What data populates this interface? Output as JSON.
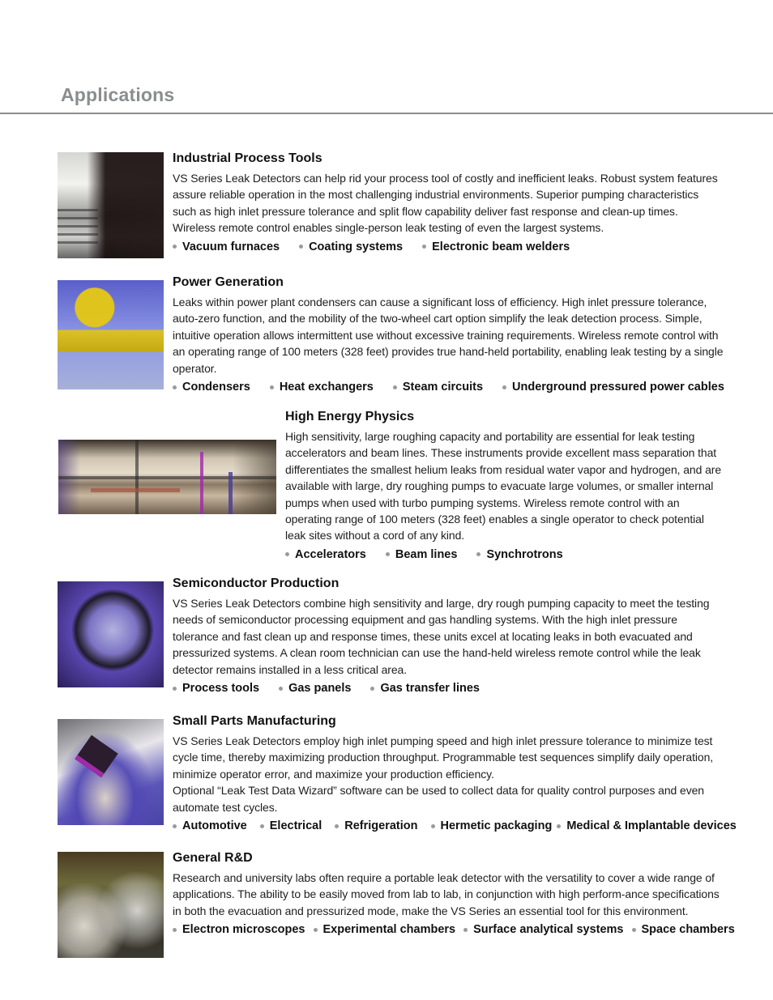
{
  "page": {
    "title": "Applications"
  },
  "sections": [
    {
      "id": "industrial",
      "heading": "Industrial Process Tools",
      "image": "industrial-process-tool-photo",
      "body": "VS Series Leak Detectors can help rid your process tool of costly and inefficient leaks. Robust system features assure reliable operation in the most challenging industrial environments. Superior pumping characteristics such as high inlet pressure tolerance and split flow capability deliver fast response and clean-up times. Wireless remote control enables single-person leak testing of even the largest systems.",
      "bullets": [
        "Vacuum furnaces",
        "Coating systems",
        "Electronic beam welders"
      ]
    },
    {
      "id": "power",
      "heading": "Power Generation",
      "image": "power-plant-valve-photo",
      "body": "Leaks within power plant condensers can cause a significant loss of efficiency. High inlet pressure tolerance, auto-zero function, and the mobility of the two-wheel cart option simplify the leak detection process. Simple, intuitive operation allows intermittent use without excessive training requirements. Wireless remote control with an operating range of 100 meters (328 feet) provides true hand-held portability, enabling leak testing by a single operator.",
      "bullets": [
        "Condensers",
        "Heat exchangers",
        "Steam circuits",
        "Underground pressured power cables"
      ]
    },
    {
      "id": "physics",
      "heading": "High Energy Physics",
      "image": "accelerator-tunnel-photo",
      "body": "High sensitivity, large roughing capacity and portability are essential for leak testing accelerators and beam lines. These instruments provide excellent mass separation that differentiates the smallest helium leaks from residual water vapor and hydrogen, and are available with large, dry roughing pumps to evacuate large volumes, or smaller internal pumps when used with turbo pumping systems. Wireless remote control with an operating range of 100 meters (328 feet) enables a single operator to check potential leak sites without a cord of any kind.",
      "bullets": [
        "Accelerators",
        "Beam lines",
        "Synchrotrons"
      ]
    },
    {
      "id": "semiconductor",
      "heading": "Semiconductor Production",
      "image": "silicon-wafer-photo",
      "body": "VS Series Leak Detectors combine high sensitivity and large, dry rough pumping capacity to meet the testing needs of semiconductor processing equipment and gas handling systems. With the high inlet pressure tolerance and fast clean up and response times, these units excel at locating leaks in both evacuated and pressurized systems. A clean room technician can use the hand-held wireless remote control while the leak detector remains installed in a less critical area.",
      "bullets": [
        "Process tools",
        "Gas panels",
        "Gas transfer lines"
      ]
    },
    {
      "id": "smallparts",
      "heading": "Small Parts Manufacturing",
      "image": "microscope-circuit-photo",
      "body": "VS Series Leak Detectors employ high inlet pumping speed and high inlet pressure tolerance to minimize test cycle time, thereby maximizing production throughput. Programmable test sequences simplify daily operation, minimize operator error, and maximize your production efficiency.",
      "body2": "Optional “Leak Test Data Wizard” software can be used to collect data for quality control purposes and even automate test cycles.",
      "bullets": [
        "Automotive",
        "Electrical",
        "Refrigeration",
        "Hermetic packaging",
        "Medical & Implantable devices"
      ]
    },
    {
      "id": "rd",
      "heading": "General R&D",
      "image": "lab-researchers-photo",
      "body": "Research and university labs often require a portable leak detector with the versatility to cover a wide range of applications. The ability to be easily moved from lab to lab, in conjunction with high perform-ance specifications in both the evacuation and pressurized mode, make the VS Series an essential tool for this environment.",
      "bullets": [
        "Electron microscopes",
        "Experimental chambers",
        "Surface analytical systems",
        "Space chambers"
      ]
    }
  ],
  "colors": {
    "title_gray": "#8a8d90",
    "rule_gray": "#8c8c8c",
    "bullet_dot": "#9a9a9a",
    "text": "#1e1e1e"
  }
}
